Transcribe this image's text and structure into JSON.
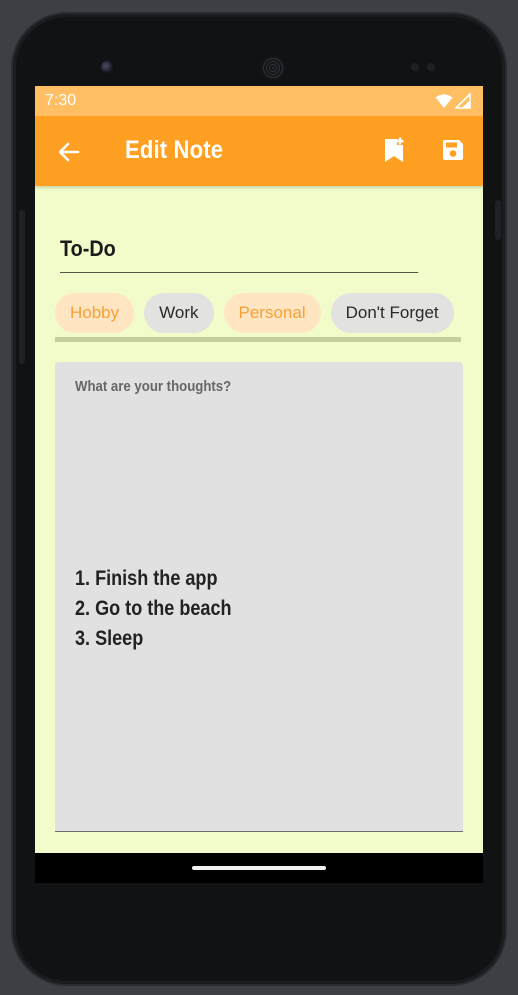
{
  "status_bar": {
    "time": "7:30"
  },
  "app_bar": {
    "title": "Edit Note"
  },
  "note": {
    "title": "To-Do",
    "hint": "What are your thoughts?",
    "lines": [
      "1. Finish the app",
      "2. Go to the beach",
      "3. Sleep"
    ]
  },
  "categories": [
    {
      "label": "Hobby",
      "selected": true
    },
    {
      "label": "Work",
      "selected": false
    },
    {
      "label": "Personal",
      "selected": true
    },
    {
      "label": "Don't Forget",
      "selected": false
    }
  ],
  "icons": {
    "back": "arrow-back-icon",
    "bookmark": "bookmark-add-icon",
    "save": "save-icon",
    "wifi": "wifi-icon",
    "signal": "signal-icon"
  },
  "colors": {
    "status_bar": "#ffbf62",
    "app_bar": "#ffa022",
    "background": "#f1fcca",
    "chip_selected_bg": "#ffe5c2",
    "chip_selected_text": "#f8a036",
    "chip_default_bg": "#e2e2e0",
    "note_bg": "#e1e1e1"
  }
}
